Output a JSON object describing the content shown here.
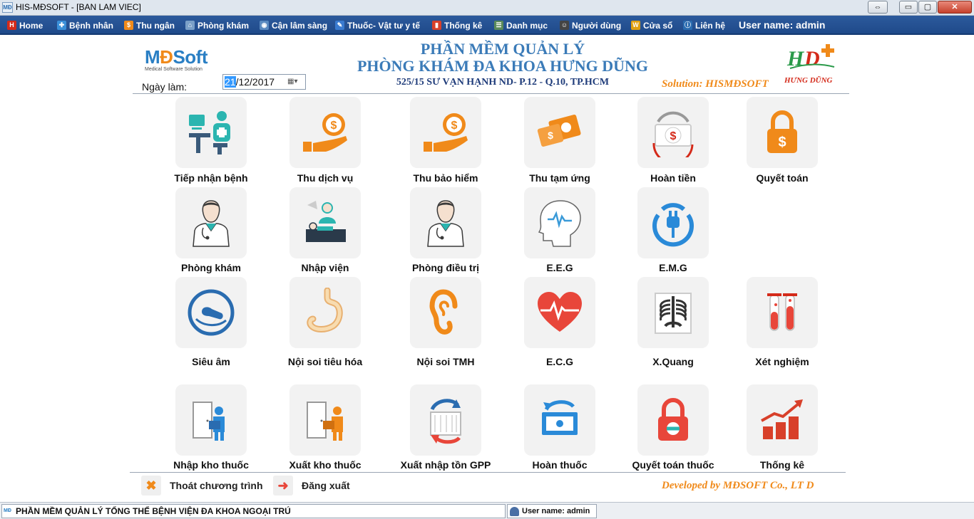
{
  "window": {
    "title": "HIS-MĐSOFT - [BAN LAM VIEC]",
    "app_icon_text": "MĐ",
    "buttons": {
      "resize": "⇔",
      "minimize": "▭",
      "maximize": "▢",
      "close": "✕"
    }
  },
  "menu": {
    "items": [
      {
        "label": "Home",
        "icon": "home-icon",
        "icon_glyph": "H",
        "color": "#d42a1a"
      },
      {
        "label": "Bệnh nhân",
        "icon": "patient-icon",
        "icon_glyph": "✚",
        "color": "#3a8fd8"
      },
      {
        "label": "Thu ngân",
        "icon": "cashier-icon",
        "icon_glyph": "$",
        "color": "#f08a1a"
      },
      {
        "label": "Phòng khám",
        "icon": "clinic-icon",
        "icon_glyph": "⌂",
        "color": "#7aa0c8"
      },
      {
        "label": "Cận lâm sàng",
        "icon": "lab-icon",
        "icon_glyph": "◉",
        "color": "#5a8ac0"
      },
      {
        "label": "Thuốc- Vật tư y tế",
        "icon": "medicine-icon",
        "icon_glyph": "✎",
        "color": "#3a7bd0"
      },
      {
        "label": "Thống kê",
        "icon": "stats-icon",
        "icon_glyph": "▮",
        "color": "#d8402a"
      },
      {
        "label": "Danh mục",
        "icon": "catalog-icon",
        "icon_glyph": "☰",
        "color": "#5a8a5a"
      },
      {
        "label": "Người dùng",
        "icon": "users-icon",
        "icon_glyph": "☺",
        "color": "#444444"
      },
      {
        "label": "Cửa sổ",
        "icon": "window-icon",
        "icon_glyph": "W",
        "color": "#e0a010"
      },
      {
        "label": "Liên hệ",
        "icon": "contact-icon",
        "icon_glyph": "ⓘ",
        "color": "#2a6cb0"
      }
    ],
    "user_label": "User name: admin"
  },
  "header": {
    "logo_brand_1": "M",
    "logo_brand_2": "Đ",
    "logo_brand_3": "Soft",
    "logo_tagline": "Medical Software Solution",
    "title_line1": "PHẦN MỀM QUẢN LÝ",
    "title_line2": "PHÒNG KHÁM ĐA KHOA HƯNG DŨNG",
    "address": "525/15 SƯ VẠN HẠNH ND- P.12 - Q.10, TP.HCM",
    "solution": "Solution: HISMĐSOFT",
    "hd_logo_text": "HƯNG DŨNG",
    "date_label": "Ngày làm:",
    "date_selected": "21",
    "date_rest": "/12/2017",
    "calendar_glyph": "▦▾"
  },
  "tiles": [
    {
      "label": "Tiếp nhận bệnh",
      "icon": "reception-icon"
    },
    {
      "label": "Thu dịch vụ",
      "icon": "service-payment-icon"
    },
    {
      "label": "Thu bảo hiểm",
      "icon": "insurance-payment-icon"
    },
    {
      "label": "Thu tạm ứng",
      "icon": "advance-payment-icon"
    },
    {
      "label": "Hoàn tiền",
      "icon": "refund-icon"
    },
    {
      "label": "Quyết toán",
      "icon": "settlement-icon"
    },
    {
      "label": "Phòng khám",
      "icon": "doctor-icon"
    },
    {
      "label": "Nhập viện",
      "icon": "admission-icon"
    },
    {
      "label": "Phòng điều trị",
      "icon": "treatment-room-icon"
    },
    {
      "label": "E.E.G",
      "icon": "eeg-icon"
    },
    {
      "label": "E.M.G",
      "icon": "emg-icon"
    },
    {
      "label": "Siêu âm",
      "icon": "ultrasound-icon"
    },
    {
      "label": "Nội soi tiêu hóa",
      "icon": "stomach-icon"
    },
    {
      "label": "Nội soi TMH",
      "icon": "ear-icon"
    },
    {
      "label": "E.C.G",
      "icon": "heart-ecg-icon"
    },
    {
      "label": "X.Quang",
      "icon": "xray-icon"
    },
    {
      "label": "Xét nghiệm",
      "icon": "test-tubes-icon"
    },
    {
      "label": "Nhập kho thuốc",
      "icon": "warehouse-in-icon"
    },
    {
      "label": "Xuất kho thuốc",
      "icon": "warehouse-out-icon"
    },
    {
      "label": "Xuất nhập tồn GPP",
      "icon": "inventory-cycle-icon"
    },
    {
      "label": "Hoàn thuốc",
      "icon": "medicine-return-icon"
    },
    {
      "label": "Quyết toán thuốc",
      "icon": "medicine-settlement-icon"
    },
    {
      "label": "Thống kê",
      "icon": "statistics-chart-icon"
    }
  ],
  "footer": {
    "exit_label": "Thoát chương trình",
    "exit_glyph": "✖",
    "logout_label": "Đăng xuất",
    "logout_glyph": "➜",
    "developed_by": "Developed by MĐSOFT Co., LT D"
  },
  "status": {
    "app_icon_text": "MĐ",
    "left_text": "PHẦN MỀM QUẢN LÝ TỔNG THỂ BỆNH VIỆN ĐA KHOA NGOẠI TRÚ",
    "right_text": "User name: admin"
  },
  "colors": {
    "menu_bg": "#1f4a8a",
    "accent_orange": "#f08a1a",
    "accent_blue": "#3b7bb8",
    "teal": "#2bb5b0",
    "red": "#e8463a"
  }
}
